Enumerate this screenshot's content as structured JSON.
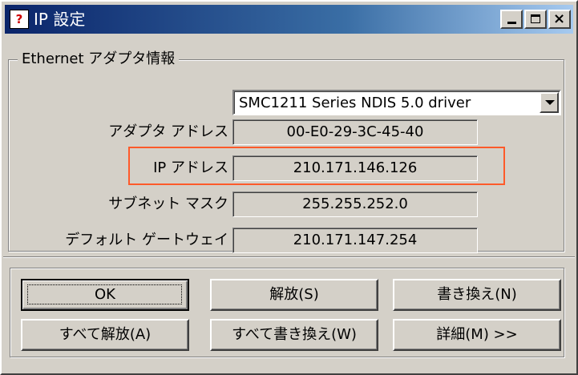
{
  "window": {
    "title": "IP 設定",
    "icon": "network-icon",
    "controls": [
      "minimize",
      "maximize",
      "close"
    ]
  },
  "adapter_group": {
    "label": "Ethernet  アダプタ情報",
    "adapter_select": "SMC1211 Series NDIS 5.0 driver",
    "rows": [
      {
        "label": "アダプタ アドレス",
        "value": "00-E0-29-3C-45-40"
      },
      {
        "label": "IP アドレス",
        "value": "210.171.146.126"
      },
      {
        "label": "サブネット マスク",
        "value": "255.255.252.0"
      },
      {
        "label": "デフォルト ゲートウェイ",
        "value": "210.171.147.254"
      }
    ],
    "highlight_color": "#ff5a2a"
  },
  "buttons": {
    "ok": "OK",
    "release": "解放(S)",
    "renew": "書き換え(N)",
    "release_all": "すべて解放(A)",
    "renew_all": "すべて書き換え(W)",
    "details": "詳細(M) >>"
  }
}
